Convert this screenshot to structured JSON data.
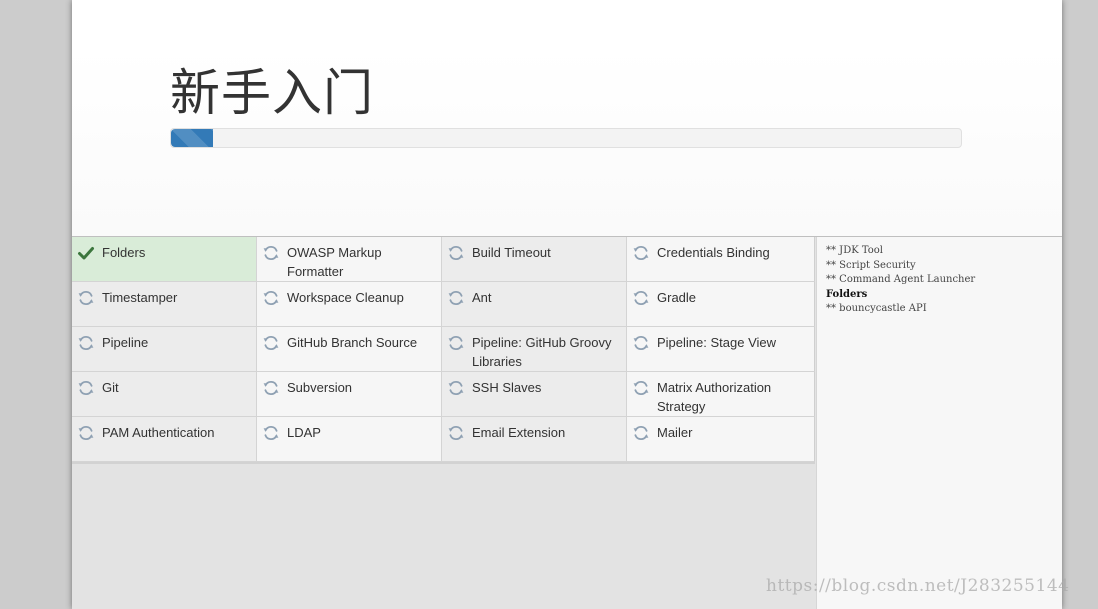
{
  "header": {
    "title": "新手入门",
    "progress_fraction": 0.053
  },
  "plugins": [
    [
      {
        "label": "Folders",
        "status": "installed"
      },
      {
        "label": "OWASP Markup Formatter",
        "status": "pending"
      },
      {
        "label": "Build Timeout",
        "status": "pending"
      },
      {
        "label": "Credentials Binding",
        "status": "pending"
      }
    ],
    [
      {
        "label": "Timestamper",
        "status": "pending"
      },
      {
        "label": "Workspace Cleanup",
        "status": "pending"
      },
      {
        "label": "Ant",
        "status": "pending"
      },
      {
        "label": "Gradle",
        "status": "pending"
      }
    ],
    [
      {
        "label": "Pipeline",
        "status": "pending"
      },
      {
        "label": "GitHub Branch Source",
        "status": "pending"
      },
      {
        "label": "Pipeline: GitHub Groovy Libraries",
        "status": "pending"
      },
      {
        "label": "Pipeline: Stage View",
        "status": "pending"
      }
    ],
    [
      {
        "label": "Git",
        "status": "pending"
      },
      {
        "label": "Subversion",
        "status": "pending"
      },
      {
        "label": "SSH Slaves",
        "status": "pending"
      },
      {
        "label": "Matrix Authorization Strategy",
        "status": "pending"
      }
    ],
    [
      {
        "label": "PAM Authentication",
        "status": "pending"
      },
      {
        "label": "LDAP",
        "status": "pending"
      },
      {
        "label": "Email Extension",
        "status": "pending"
      },
      {
        "label": "Mailer",
        "status": "pending"
      }
    ]
  ],
  "install_log": [
    {
      "text": "** JDK Tool",
      "active": false
    },
    {
      "text": "** Script Security",
      "active": false
    },
    {
      "text": "** Command Agent Launcher",
      "active": false
    },
    {
      "text": "Folders",
      "active": true
    },
    {
      "text": "** bouncycastle API",
      "active": false
    }
  ],
  "watermark": "https://blog.csdn.net/J283255144",
  "icons": {
    "installed": "checkmark-icon",
    "pending": "refresh-icon"
  },
  "colors": {
    "progress": "#337ab7",
    "installed_cell": "#d9ecd8",
    "check": "#3c763d",
    "refresh": "#8fa1b3"
  }
}
